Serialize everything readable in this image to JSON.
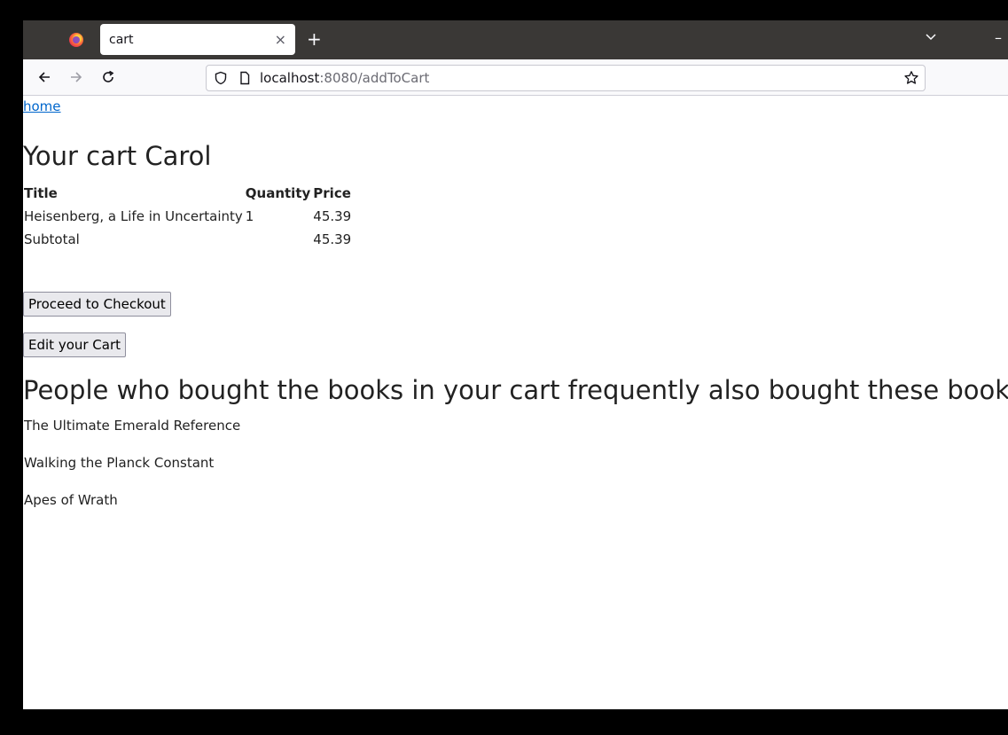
{
  "browser": {
    "tab_title": "cart",
    "close_glyph": "×",
    "newtab_glyph": "+",
    "minimize_glyph": "–",
    "url_host": "localhost",
    "url_rest": ":8080/addToCart"
  },
  "page": {
    "home_link": "home",
    "cart_title": "Your cart Carol",
    "table": {
      "headers": [
        "Title",
        "Quantity",
        "Price"
      ],
      "rows": [
        {
          "title": "Heisenberg, a Life in Uncertainty",
          "quantity": "1",
          "price": "45.39"
        }
      ],
      "subtotal_label": "Subtotal",
      "subtotal_value": "45.39"
    },
    "checkout_button": "Proceed to Checkout",
    "edit_button": "Edit your Cart",
    "recommend_title": "People who bought the books in your cart frequently also bought these books",
    "recommendations": [
      "The Ultimate Emerald Reference",
      "Walking the Planck Constant",
      "Apes of Wrath"
    ]
  },
  "icons": [
    "firefox-logo-icon",
    "close-icon",
    "plus-icon",
    "chevron-down-icon",
    "minimize-icon",
    "back-arrow-icon",
    "forward-arrow-icon",
    "reload-icon",
    "shield-icon",
    "page-icon",
    "star-icon"
  ],
  "colors": {
    "tabbar": "#3a3836",
    "navbar": "#f9f9fb",
    "link": "#0066cc",
    "text": "#222222",
    "button_bg": "#e9e9ed"
  }
}
